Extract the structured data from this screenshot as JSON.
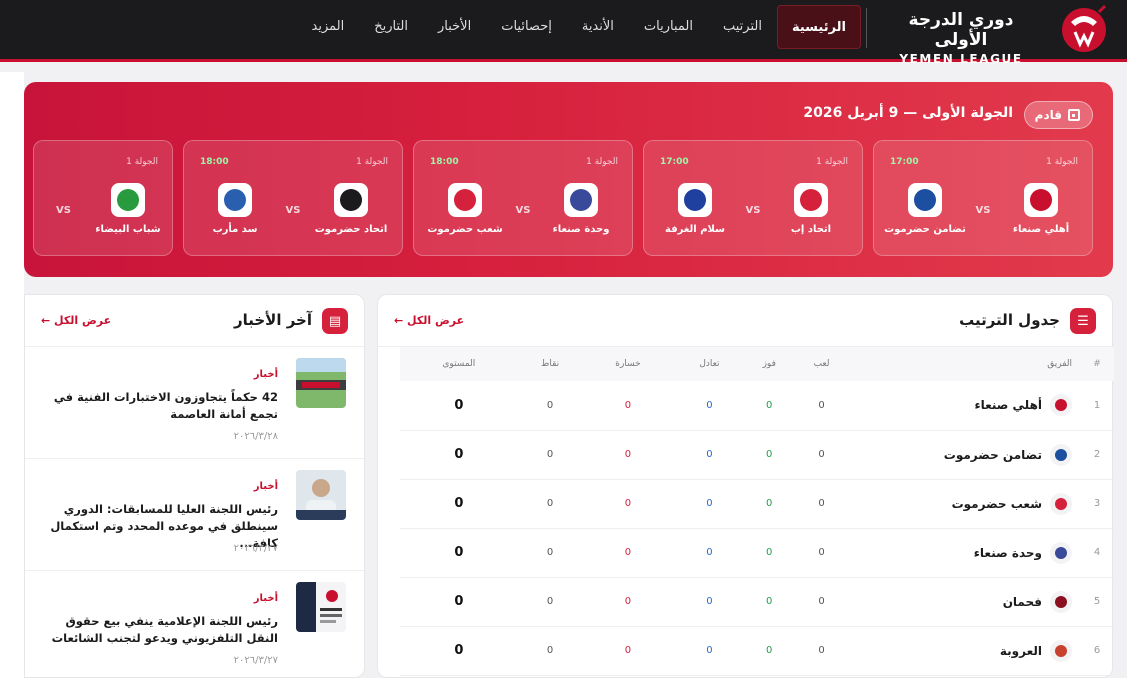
{
  "brand": {
    "name_ar": "دوري الدرجة الأولى",
    "name_en": "YEMEN LEAGUE"
  },
  "nav": {
    "items": [
      {
        "label": "الرئيسية",
        "active": true
      },
      {
        "label": "الترتيب"
      },
      {
        "label": "المباريات"
      },
      {
        "label": "الأندية"
      },
      {
        "label": "إحصائيات"
      },
      {
        "label": "الأخبار"
      },
      {
        "label": "التاريخ"
      },
      {
        "label": "المزيد"
      }
    ]
  },
  "hero": {
    "badge": "قادم",
    "title": "الجولة الأولى — 9 أبريل 2026",
    "vs_label": "VS",
    "matches": [
      {
        "round": "الجولة 1",
        "time": "17:00",
        "home": "أهلي صنعاء",
        "away": "تضامن حضرموت",
        "home_color": "#c8102e",
        "away_color": "#1c4fa0"
      },
      {
        "round": "الجولة 1",
        "time": "17:00",
        "home": "اتحاد إب",
        "away": "سلام الغرفة",
        "home_color": "#d6213c",
        "away_color": "#2040a0"
      },
      {
        "round": "الجولة 1",
        "time": "18:00",
        "home": "وحدة صنعاء",
        "away": "شعب حضرموت",
        "home_color": "#3a4a9a",
        "away_color": "#d6213c"
      },
      {
        "round": "الجولة 1",
        "time": "18:00",
        "home": "اتحاد حضرموت",
        "away": "سد مأرب",
        "home_color": "#1b1b1d",
        "away_color": "#2a5fb0"
      },
      {
        "round": "الجولة 1",
        "time": "",
        "home": "شباب البيضاء",
        "away": "",
        "home_color": "#2a9a3e",
        "away_color": ""
      }
    ]
  },
  "standings": {
    "title": "جدول الترتيب",
    "view_all": "عرض الكل ←",
    "columns": {
      "rank": "#",
      "team": "الفريق",
      "played": "لعب",
      "won": "فوز",
      "drawn": "تعادل",
      "lost": "خسارة",
      "points": "نقاط",
      "form": "المستوى"
    },
    "rows": [
      {
        "rank": "1",
        "team": "أهلي صنعاء",
        "played": "0",
        "won": "0",
        "drawn": "0",
        "lost": "0",
        "points": "0",
        "form": "0",
        "color": "#c8102e"
      },
      {
        "rank": "2",
        "team": "تضامن حضرموت",
        "played": "0",
        "won": "0",
        "drawn": "0",
        "lost": "0",
        "points": "0",
        "form": "0",
        "color": "#1c4fa0"
      },
      {
        "rank": "3",
        "team": "شعب حضرموت",
        "played": "0",
        "won": "0",
        "drawn": "0",
        "lost": "0",
        "points": "0",
        "form": "0",
        "color": "#d6213c"
      },
      {
        "rank": "4",
        "team": "وحدة صنعاء",
        "played": "0",
        "won": "0",
        "drawn": "0",
        "lost": "0",
        "points": "0",
        "form": "0",
        "color": "#3a4a9a"
      },
      {
        "rank": "5",
        "team": "فحمان",
        "played": "0",
        "won": "0",
        "drawn": "0",
        "lost": "0",
        "points": "0",
        "form": "0",
        "color": "#8a1020"
      },
      {
        "rank": "6",
        "team": "العروبة",
        "played": "0",
        "won": "0",
        "drawn": "0",
        "lost": "0",
        "points": "0",
        "form": "0",
        "color": "#c8402e"
      }
    ]
  },
  "news": {
    "title": "آخر الأخبار",
    "view_all": "عرض الكل ←",
    "items": [
      {
        "tag": "أخبار",
        "title": "42 حكماً يتجاوزون الاختبارات الفنية في تجمع أمانة العاصمة",
        "date": "٢٠٢٦/٣/٢٨",
        "thumb": "field"
      },
      {
        "tag": "أخبار",
        "title": "رئيس اللجنة العليا للمسابقات: الدوري سينطلق في موعده المحدد وتم استكمال كافة...",
        "date": "٢٠٢٦/٣/٢٧",
        "thumb": "person"
      },
      {
        "tag": "أخبار",
        "title": "رئيس اللجنة الإعلامية ينفي بيع حقوق النقل التلفزيوني ويدعو لتجنب الشائعات",
        "date": "٢٠٢٦/٣/٢٧",
        "thumb": "poster"
      }
    ]
  }
}
